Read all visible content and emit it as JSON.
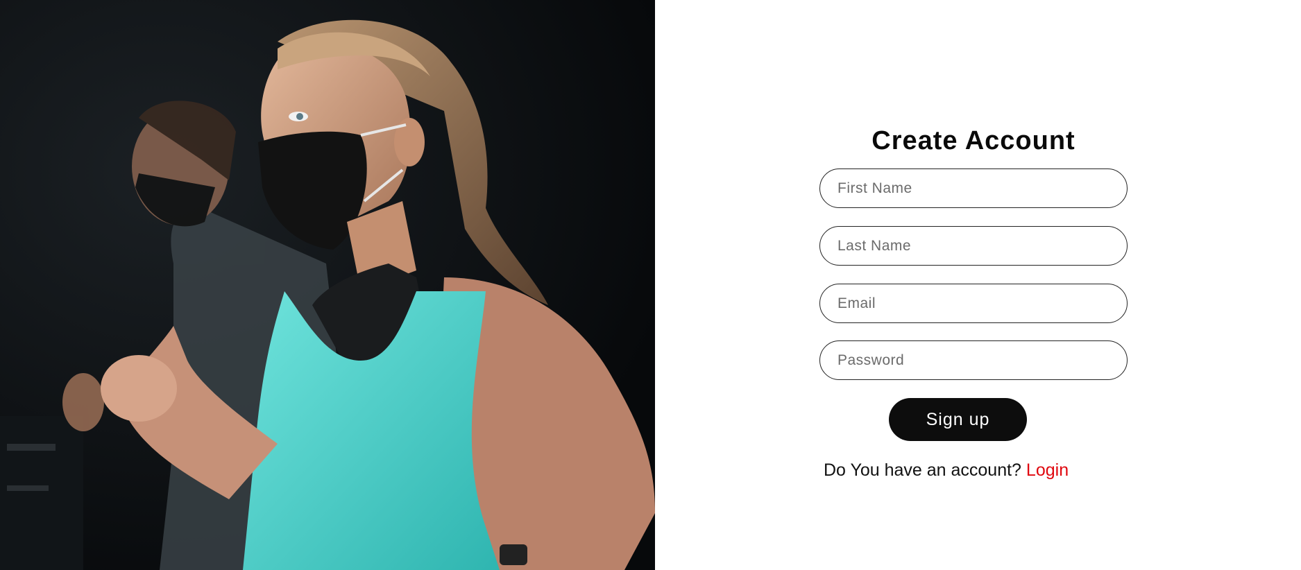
{
  "hero": {
    "image": "photo-woman-and-man-running-on-treadmills-wearing-face-masks"
  },
  "form": {
    "title": "Create Account",
    "first_name_placeholder": "First Name",
    "last_name_placeholder": "Last Name",
    "email_placeholder": "Email",
    "password_placeholder": "Password",
    "submit_label": "Sign up",
    "login_prompt": "Do You have an account?",
    "login_link_label": "Login"
  },
  "colors": {
    "button_bg": "#0d0d0d",
    "link": "#e0080f",
    "field_border": "#222222",
    "tank_top": "#52d4cf"
  }
}
